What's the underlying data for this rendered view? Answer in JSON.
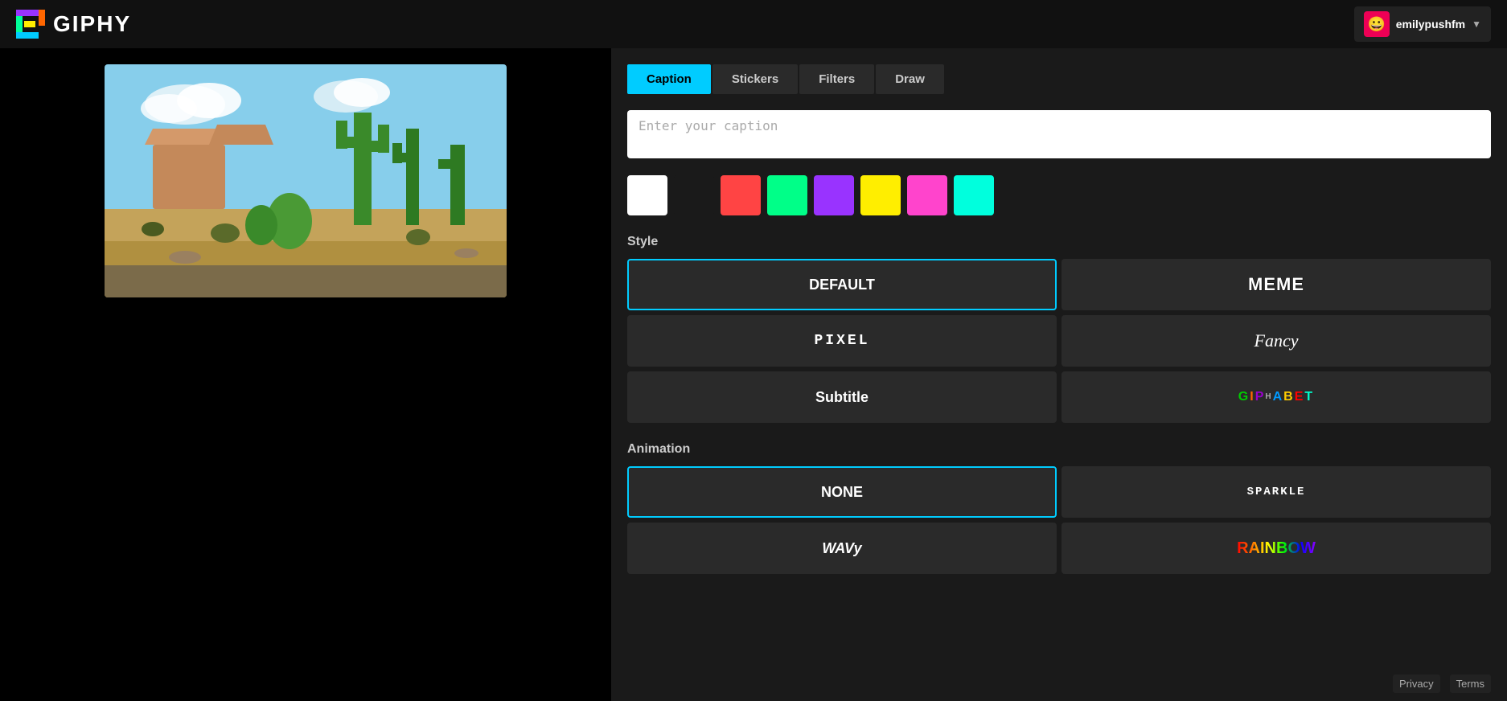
{
  "header": {
    "logo_text": "GIPHY",
    "username": "emilypushfm",
    "avatar_emoji": "😀"
  },
  "tabs": [
    {
      "id": "caption",
      "label": "Caption",
      "active": true
    },
    {
      "id": "stickers",
      "label": "Stickers",
      "active": false
    },
    {
      "id": "filters",
      "label": "Filters",
      "active": false
    },
    {
      "id": "draw",
      "label": "Draw",
      "active": false
    }
  ],
  "caption_input": {
    "placeholder": "Enter your caption",
    "value": ""
  },
  "colors": [
    {
      "id": "white",
      "hex": "#FFFFFF",
      "selected": true
    },
    {
      "id": "black",
      "hex": "#1a1a1a"
    },
    {
      "id": "red",
      "hex": "#FF4444"
    },
    {
      "id": "green",
      "hex": "#00FF88"
    },
    {
      "id": "purple",
      "hex": "#9933FF"
    },
    {
      "id": "yellow",
      "hex": "#FFEE00"
    },
    {
      "id": "pink",
      "hex": "#FF44CC"
    },
    {
      "id": "cyan",
      "hex": "#00FFDD"
    }
  ],
  "style_section": {
    "label": "Style",
    "options": [
      {
        "id": "default",
        "label": "DEFAULT",
        "selected": true
      },
      {
        "id": "meme",
        "label": "MEME"
      },
      {
        "id": "pixel",
        "label": "PIXEL"
      },
      {
        "id": "fancy",
        "label": "Fancy"
      },
      {
        "id": "subtitle",
        "label": "Subtitle"
      },
      {
        "id": "alphabet",
        "label": "GIPHABET"
      }
    ]
  },
  "animation_section": {
    "label": "Animation",
    "options": [
      {
        "id": "none",
        "label": "NONE",
        "selected": true
      },
      {
        "id": "sparkle",
        "label": "SPARKLE"
      },
      {
        "id": "wavy",
        "label": "WAVy"
      },
      {
        "id": "rainbow",
        "label": "RAINBOW"
      }
    ]
  },
  "footer": {
    "privacy_label": "Privacy",
    "terms_label": "Terms"
  }
}
